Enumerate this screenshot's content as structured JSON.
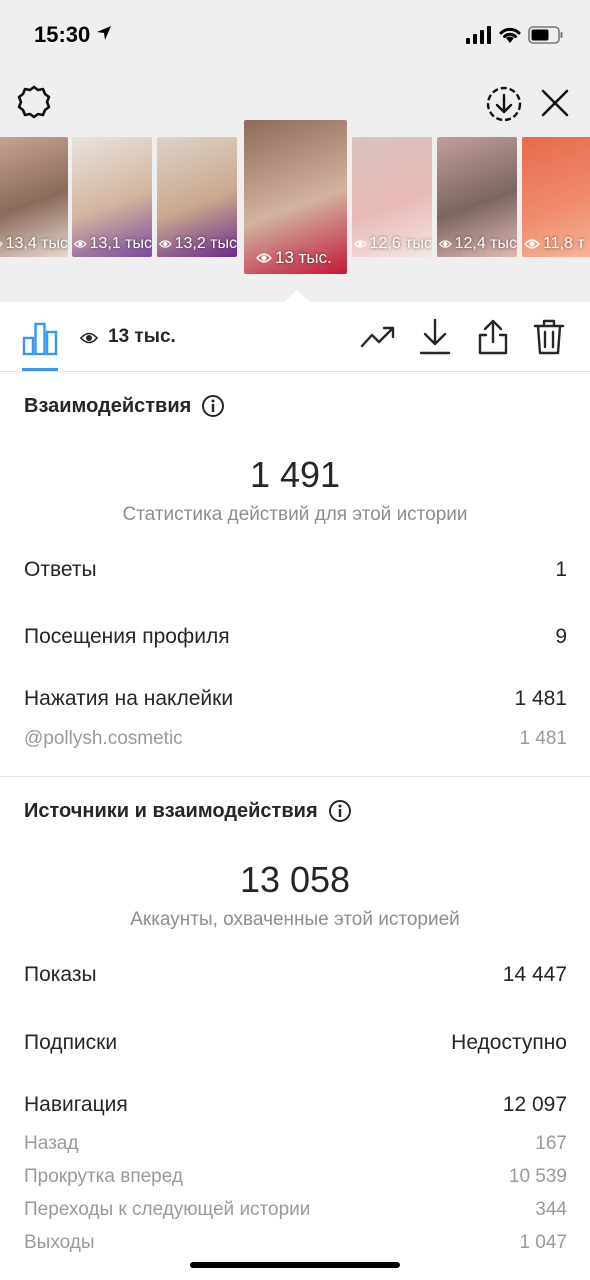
{
  "status_bar": {
    "time": "15:30"
  },
  "stories": [
    {
      "count": "13,4 тыс",
      "colors": [
        "#c9a793",
        "#8a6a5a",
        "#e8d8cf"
      ]
    },
    {
      "count": "13,1 тыс",
      "colors": [
        "#e9e3de",
        "#d3b59e",
        "#7a4aa0"
      ]
    },
    {
      "count": "13,2 тыс",
      "colors": [
        "#ddd3c9",
        "#caa88e",
        "#6b2c8c"
      ]
    },
    {
      "count": "13 тыс.",
      "colors": [
        "#8f6a58",
        "#d2b3a0",
        "#c2183a"
      ]
    },
    {
      "count": "12,6 тыс",
      "colors": [
        "#d9c3bd",
        "#e8b9b6",
        "#f4e6e2"
      ]
    },
    {
      "count": "12,4 тыс",
      "colors": [
        "#c19f9b",
        "#7c6561",
        "#e0bab4"
      ]
    },
    {
      "count": "11,8 т",
      "colors": [
        "#e76a4d",
        "#f08a6b",
        "#f7b59d"
      ]
    }
  ],
  "toolbar": {
    "views": "13 тыс."
  },
  "interactions": {
    "title": "Взаимодействия",
    "total": "1 491",
    "caption": "Статистика действий для этой истории",
    "rows": [
      {
        "label": "Ответы",
        "value": "1"
      },
      {
        "label": "Посещения профиля",
        "value": "9"
      },
      {
        "label": "Нажатия на наклейки",
        "value": "1 481"
      }
    ],
    "sticker": {
      "label": "@pollysh.cosmetic",
      "value": "1 481"
    }
  },
  "reach": {
    "title": "Источники и взаимодействия",
    "total": "13 058",
    "caption": "Аккаунты, охваченные этой историей",
    "rows": [
      {
        "label": "Показы",
        "value": "14 447"
      },
      {
        "label": "Подписки",
        "value": "Недоступно"
      },
      {
        "label": "Навигация",
        "value": "12 097"
      }
    ],
    "navigation": [
      {
        "label": "Назад",
        "value": "167"
      },
      {
        "label": "Прокрутка вперед",
        "value": "10 539"
      },
      {
        "label": "Переходы к следующей истории",
        "value": "344"
      },
      {
        "label": "Выходы",
        "value": "1 047"
      }
    ]
  },
  "colors": {
    "accent": "#3897f0",
    "muted": "#8e8e8e",
    "text": "#262626"
  }
}
